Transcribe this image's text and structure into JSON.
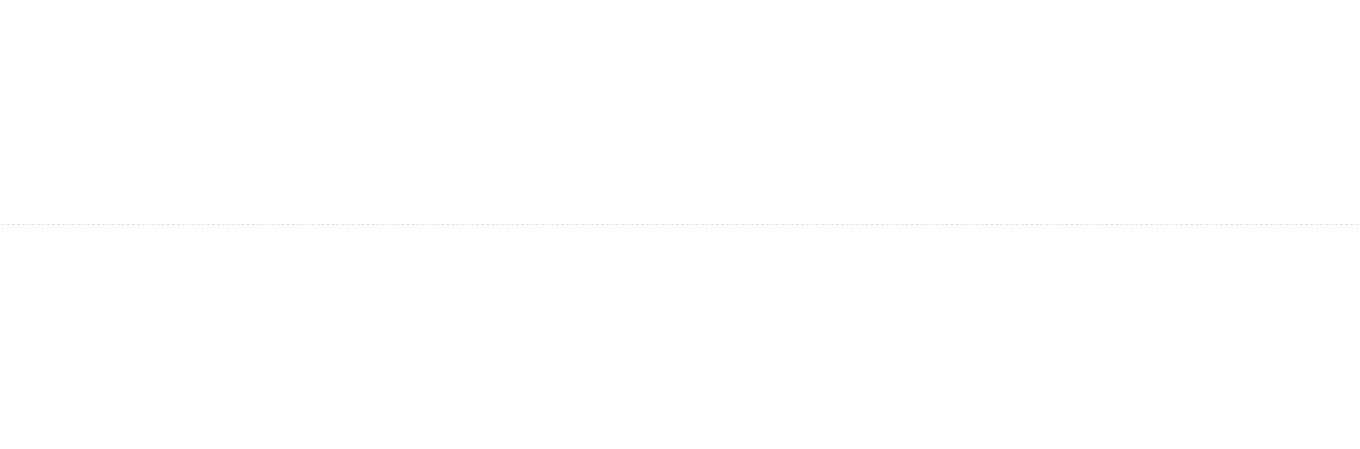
{
  "colors": {
    "background": "#ffffff",
    "divider": "#e6e6e6"
  }
}
